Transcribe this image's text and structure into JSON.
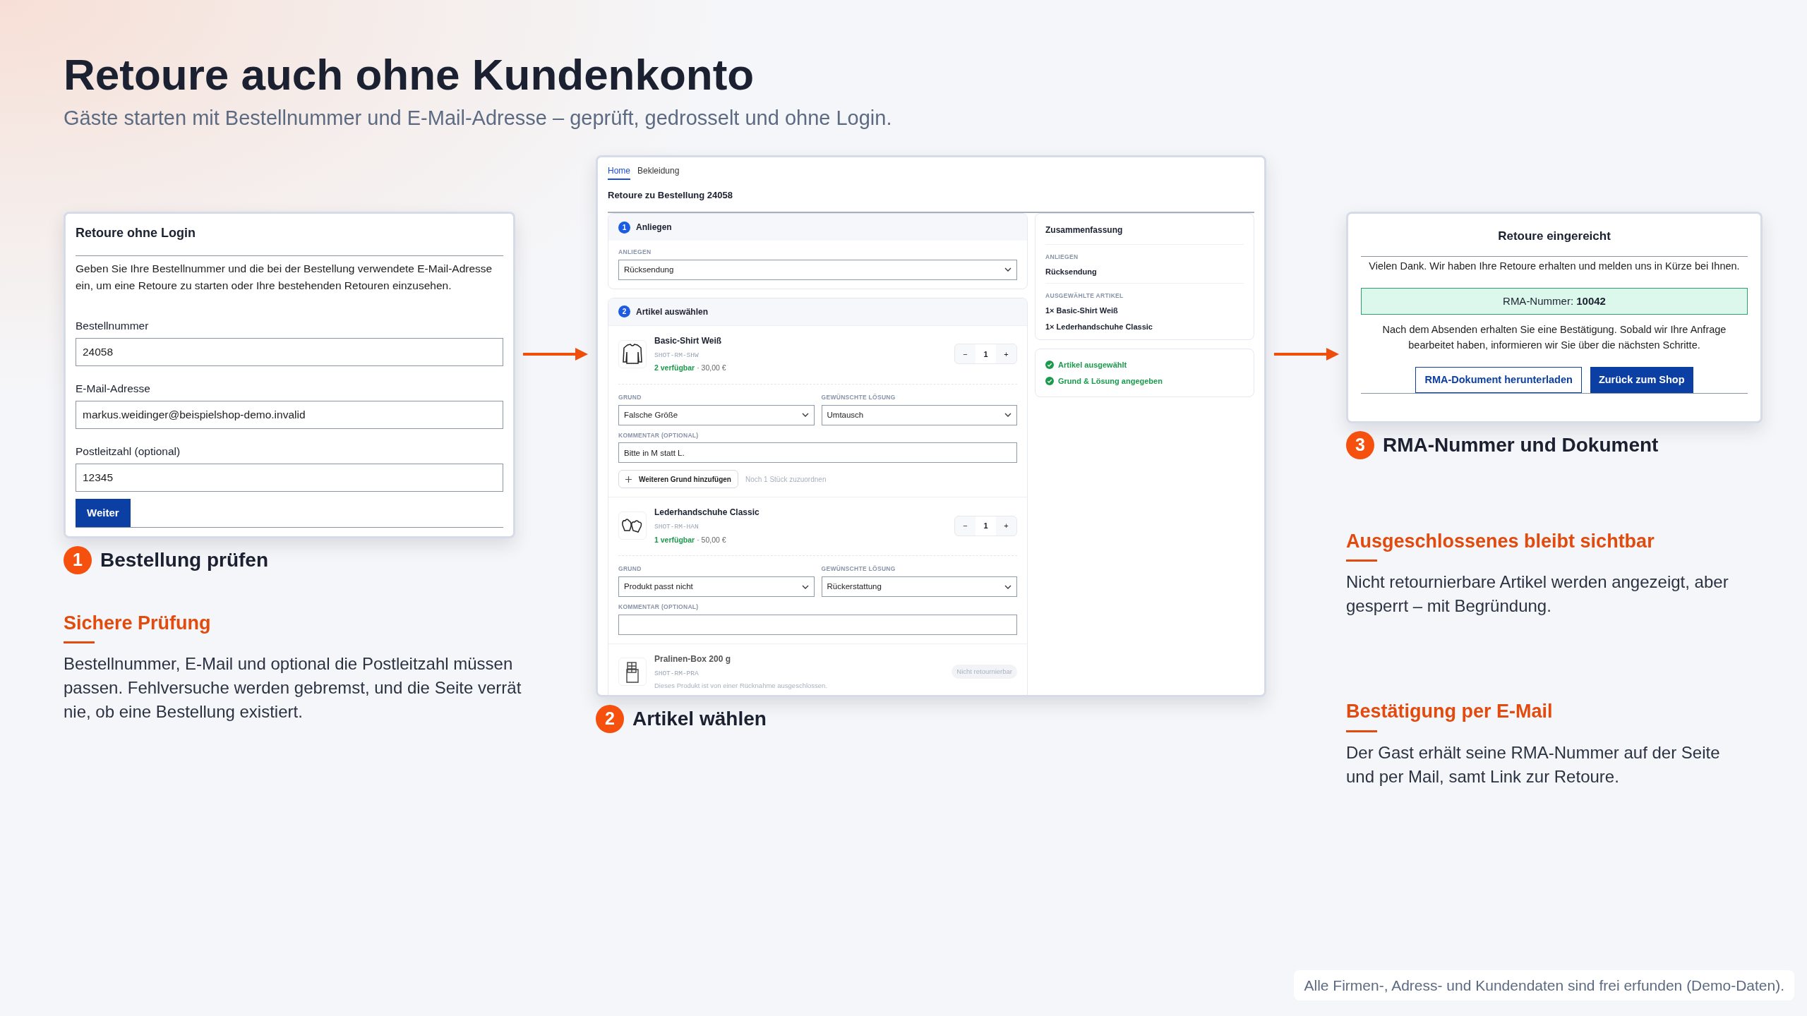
{
  "title": "Retoure auch ohne Kundenkonto",
  "subtitle": "Gäste starten mit Bestellnummer und E-Mail-Adresse – geprüft, gedrosselt und ohne Login.",
  "login_panel": {
    "title": "Retoure ohne Login",
    "intro": "Geben Sie Ihre Bestellnummer und die bei der Bestellung verwendete E-Mail-Adresse ein, um eine Retoure zu starten oder Ihre bestehenden Retouren einzusehen.",
    "fields": [
      {
        "label": "Bestellnummer",
        "value": "24058"
      },
      {
        "label": "E-Mail-Adresse",
        "value": "markus.weidinger@beispielshop-demo.invalid"
      },
      {
        "label": "Postleitzahl (optional)",
        "value": "12345"
      }
    ],
    "button": "Weiter"
  },
  "return_panel": {
    "breadcrumb": [
      {
        "label": "Home",
        "selected": true
      },
      {
        "label": "Bekleidung",
        "selected": false
      }
    ],
    "heading": "Retoure zu Bestellung 24058",
    "sections": [
      {
        "number": "1",
        "title": "Anliegen"
      },
      {
        "number": "2",
        "title": "Artikel auswählen"
      }
    ],
    "concern": {
      "label": "ANLIEGEN",
      "value": "Rücksendung"
    },
    "items": [
      {
        "kind": "returnable",
        "name": "Basic-Shirt Weiß",
        "sku": "SHOT-RM-SHW",
        "availability": "2 verfügbar",
        "price": "· 30,00 €",
        "decrement": "−",
        "quantity": "1",
        "increment": "+",
        "reason_label": "GRUND",
        "reason": "Falsche Größe",
        "solution_label": "GEWÜNSCHTE LÖSUNG",
        "solution": "Umtausch",
        "comment_label": "KOMMENTAR (OPTIONAL)",
        "comment": "Bitte in M statt L.",
        "add_button": "Weiteren Grund hinzufügen",
        "remaining": "Noch 1 Stück zuzuordnen"
      },
      {
        "kind": "returnable",
        "name": "Lederhandschuhe Classic",
        "sku": "SHOT-RM-HAN",
        "availability": "1 verfügbar",
        "price": "· 50,00 €",
        "decrement": "−",
        "quantity": "1",
        "increment": "+",
        "reason_label": "GRUND",
        "reason": "Produkt passt nicht",
        "solution_label": "GEWÜNSCHTE LÖSUNG",
        "solution": "Rückerstattung",
        "comment_label": "KOMMENTAR (OPTIONAL)"
      },
      {
        "kind": "excluded",
        "name": "Pralinen-Box 200 g",
        "sku": "SHOT-RM-PRA",
        "note": "Dieses Produkt ist von einer Rücknahme ausgeschlossen.",
        "badge": "Nicht retournierbar"
      }
    ],
    "summary": {
      "title": "Zusammenfassung",
      "concern_label": "ANLIEGEN",
      "concern": "Rücksendung",
      "items_label": "AUSGEWÄHLTE ARTIKEL",
      "items": [
        "1× Basic-Shirt Weiß",
        "1× Lederhandschuhe Classic"
      ]
    },
    "checks": [
      {
        "label": "Artikel ausgewählt",
        "done": true
      },
      {
        "label": "Grund & Lösung angegeben",
        "done": true
      }
    ]
  },
  "confirmation_panel": {
    "title": "Retoure eingereicht",
    "message": "Vielen Dank. Wir haben Ihre Retoure erhalten und melden uns in Kürze bei Ihnen.",
    "rma": "RMA-Nummer: **10042**",
    "info": "Nach dem Absenden erhalten Sie eine Bestätigung. Sobald wir Ihre Anfrage bearbeitet haben, informieren wir Sie über die nächsten Schritte.",
    "buttons": [
      {
        "label": "RMA-Dokument herunterladen",
        "kind": "outline"
      },
      {
        "label": "Zurück zum Shop",
        "kind": "primary"
      }
    ]
  },
  "steps": [
    {
      "number": "1",
      "caption": "Bestellung prüfen"
    },
    {
      "number": "2",
      "caption": "Artikel wählen"
    },
    {
      "number": "3",
      "caption": "RMA-Nummer und Dokument"
    }
  ],
  "features": [
    {
      "heading": "Sichere Prüfung",
      "body": "Bestellnummer, E-Mail und optional die Postleitzahl müssen passen. Fehlversuche werden gebremst, und die Seite verrät nie, ob eine Bestellung existiert."
    },
    {
      "heading": "Ausgeschlossenes bleibt sichtbar",
      "body": "Nicht retournierbare Artikel werden angezeigt, aber gesperrt – mit Begründung."
    },
    {
      "heading": "Bestätigung per E-Mail",
      "body": "Der Gast erhält seine RMA-Nummer auf der Seite und per Mail, samt Link zur Retoure."
    }
  ],
  "footnote": "Alle Firmen-, Adress- und Kundendaten sind frei erfunden (Demo-Daten)."
}
